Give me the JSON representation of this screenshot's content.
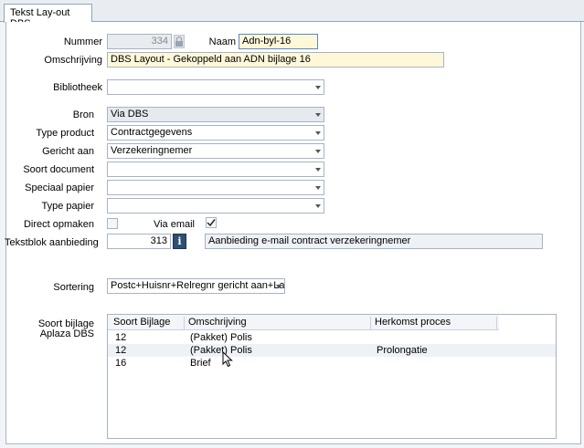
{
  "tab": {
    "label": "Tekst Lay-out DBS"
  },
  "form": {
    "nummer_label": "Nummer",
    "nummer_value": "334",
    "naam_label": "Naam",
    "naam_value": "Adn-byl-16",
    "omschrijving_label": "Omschrijving",
    "omschrijving_value": "DBS Layout - Gekoppeld aan ADN bijlage 16",
    "bibliotheek_label": "Bibliotheek",
    "bibliotheek_value": "",
    "bron_label": "Bron",
    "bron_value": "Via DBS",
    "type_product_label": "Type product",
    "type_product_value": "Contractgegevens",
    "gericht_aan_label": "Gericht aan",
    "gericht_aan_value": "Verzekeringnemer",
    "soort_document_label": "Soort document",
    "soort_document_value": "",
    "speciaal_papier_label": "Speciaal papier",
    "speciaal_papier_value": "",
    "type_papier_label": "Type papier",
    "type_papier_value": "",
    "direct_opmaken_label": "Direct opmaken",
    "direct_opmaken_checked": false,
    "via_email_label": "Via email",
    "via_email_checked": true,
    "tekstblok_label": "Tekstblok aanbieding",
    "tekstblok_value": "313",
    "tekstblok_info_icon": "i",
    "tekstblok_desc": "Aanbieding e-mail contract verzekeringnemer",
    "sortering_label": "Sortering",
    "sortering_value": "Postc+Huisnr+Relregnr gericht aan+Layc",
    "soort_bijlage_label_1": "Soort bijlage",
    "soort_bijlage_label_2": "Aplaza DBS"
  },
  "grid": {
    "columns": [
      "Soort Bijlage",
      "Omschrijving",
      "Herkomst proces"
    ],
    "rows": [
      {
        "soort": "12",
        "omschrijving": "(Pakket) Polis",
        "herkomst": ""
      },
      {
        "soort": "12",
        "omschrijving": "(Pakket) Polis",
        "herkomst": "Prolongatie"
      },
      {
        "soort": "16",
        "omschrijving": "Brief",
        "herkomst": ""
      }
    ]
  },
  "colors": {
    "accent": "#2f4f73",
    "required_bg": "#fff8d8",
    "border": "#a7b3c3"
  },
  "icons": [
    "lock-icon",
    "info-icon",
    "dropdown-arrow-icon",
    "checkmark-icon",
    "mouse-cursor-icon"
  ]
}
